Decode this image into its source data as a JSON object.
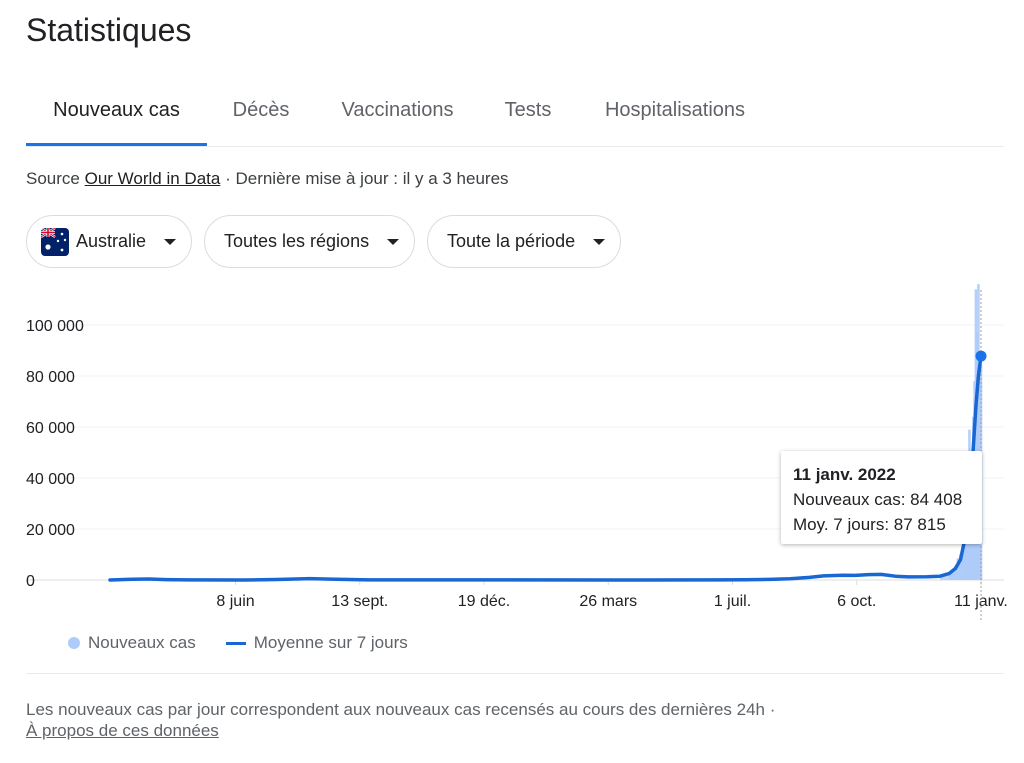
{
  "header": {
    "title": "Statistiques"
  },
  "tabs": [
    {
      "label": "Nouveaux cas",
      "active": true
    },
    {
      "label": "Décès",
      "active": false
    },
    {
      "label": "Vaccinations",
      "active": false
    },
    {
      "label": "Tests",
      "active": false
    },
    {
      "label": "Hospitalisations",
      "active": false
    }
  ],
  "source": {
    "prefix": "Source",
    "link": "Our World in Data",
    "updated": "· Dernière mise à jour : il y a 3 heures"
  },
  "filters": {
    "country": "Australie",
    "region": "Toutes les régions",
    "period": "Toute la période"
  },
  "tooltip": {
    "date": "11 janv. 2022",
    "new_cases": "Nouveaux cas: 84 408",
    "avg": "Moy. 7 jours: 87 815"
  },
  "legend": {
    "bars": "Nouveaux cas",
    "line": "Moyenne sur 7 jours"
  },
  "footnote": {
    "text": "Les nouveaux cas par jour correspondent aux nouveaux cas recensés au cours des dernières 24h  ·",
    "link": "À propos de ces données"
  },
  "colors": {
    "accent": "#1a73e8",
    "line": "#1967d2",
    "bars": "#aecbfa",
    "flag_blue": "#012169",
    "flag_red": "#c8102e"
  },
  "chart_data": {
    "type": "line",
    "ylim": [
      0,
      100000
    ],
    "y_ticks": [
      0,
      20000,
      40000,
      60000,
      80000,
      100000
    ],
    "y_tick_labels": [
      "0",
      "20 000",
      "40 000",
      "60 000",
      "80 000",
      "100 000"
    ],
    "x_tick_labels": [
      "8 juin",
      "13 sept.",
      "19 déc.",
      "26 mars",
      "1 juil.",
      "6 oct.",
      "11 janv."
    ],
    "x_tick_dates": [
      "2020-06-08",
      "2020-09-13",
      "2020-12-19",
      "2021-03-26",
      "2021-07-01",
      "2021-10-06",
      "2022-01-11"
    ],
    "x_start": "2020-03-02",
    "x_end": "2022-01-11",
    "grid": true,
    "legend_position": "bottom-left",
    "series": [
      {
        "name": "Moyenne sur 7 jours",
        "type": "line",
        "points": [
          [
            "2020-03-02",
            0
          ],
          [
            "2020-03-20",
            300
          ],
          [
            "2020-04-01",
            400
          ],
          [
            "2020-04-15",
            150
          ],
          [
            "2020-05-01",
            20
          ],
          [
            "2020-06-15",
            10
          ],
          [
            "2020-07-10",
            200
          ],
          [
            "2020-08-05",
            550
          ],
          [
            "2020-08-25",
            300
          ],
          [
            "2020-09-20",
            40
          ],
          [
            "2020-10-15",
            20
          ],
          [
            "2021-01-01",
            20
          ],
          [
            "2021-04-01",
            10
          ],
          [
            "2021-06-20",
            20
          ],
          [
            "2021-07-10",
            80
          ],
          [
            "2021-07-30",
            230
          ],
          [
            "2021-08-15",
            500
          ],
          [
            "2021-08-30",
            1000
          ],
          [
            "2021-09-10",
            1600
          ],
          [
            "2021-09-25",
            1900
          ],
          [
            "2021-10-05",
            1800
          ],
          [
            "2021-10-15",
            2100
          ],
          [
            "2021-10-25",
            2200
          ],
          [
            "2021-11-05",
            1500
          ],
          [
            "2021-11-15",
            1200
          ],
          [
            "2021-11-30",
            1300
          ],
          [
            "2021-12-10",
            1500
          ],
          [
            "2021-12-17",
            2500
          ],
          [
            "2021-12-22",
            4500
          ],
          [
            "2021-12-26",
            8000
          ],
          [
            "2021-12-29",
            15000
          ],
          [
            "2022-01-01",
            25000
          ],
          [
            "2022-01-03",
            38000
          ],
          [
            "2022-01-05",
            52000
          ],
          [
            "2022-01-07",
            68000
          ],
          [
            "2022-01-09",
            80000
          ],
          [
            "2022-01-11",
            87815
          ]
        ]
      },
      {
        "name": "Nouveaux cas",
        "type": "bar",
        "points": [
          [
            "2021-12-18",
            3000
          ],
          [
            "2021-12-20",
            3500
          ],
          [
            "2021-12-22",
            5500
          ],
          [
            "2021-12-24",
            8500
          ],
          [
            "2021-12-26",
            10000
          ],
          [
            "2021-12-28",
            18000
          ],
          [
            "2021-12-29",
            21000
          ],
          [
            "2021-12-30",
            32000
          ],
          [
            "2021-12-31",
            32500
          ],
          [
            "2022-01-01",
            35000
          ],
          [
            "2022-01-02",
            59000
          ],
          [
            "2022-01-03",
            38000
          ],
          [
            "2022-01-04",
            47000
          ],
          [
            "2022-01-05",
            64000
          ],
          [
            "2022-01-06",
            78000
          ],
          [
            "2022-01-07",
            114000
          ],
          [
            "2022-01-08",
            97000
          ],
          [
            "2022-01-09",
            116000
          ],
          [
            "2022-01-10",
            77000
          ],
          [
            "2022-01-11",
            84408
          ]
        ]
      }
    ],
    "highlight": {
      "date": "2022-01-11",
      "value": 87815
    }
  }
}
